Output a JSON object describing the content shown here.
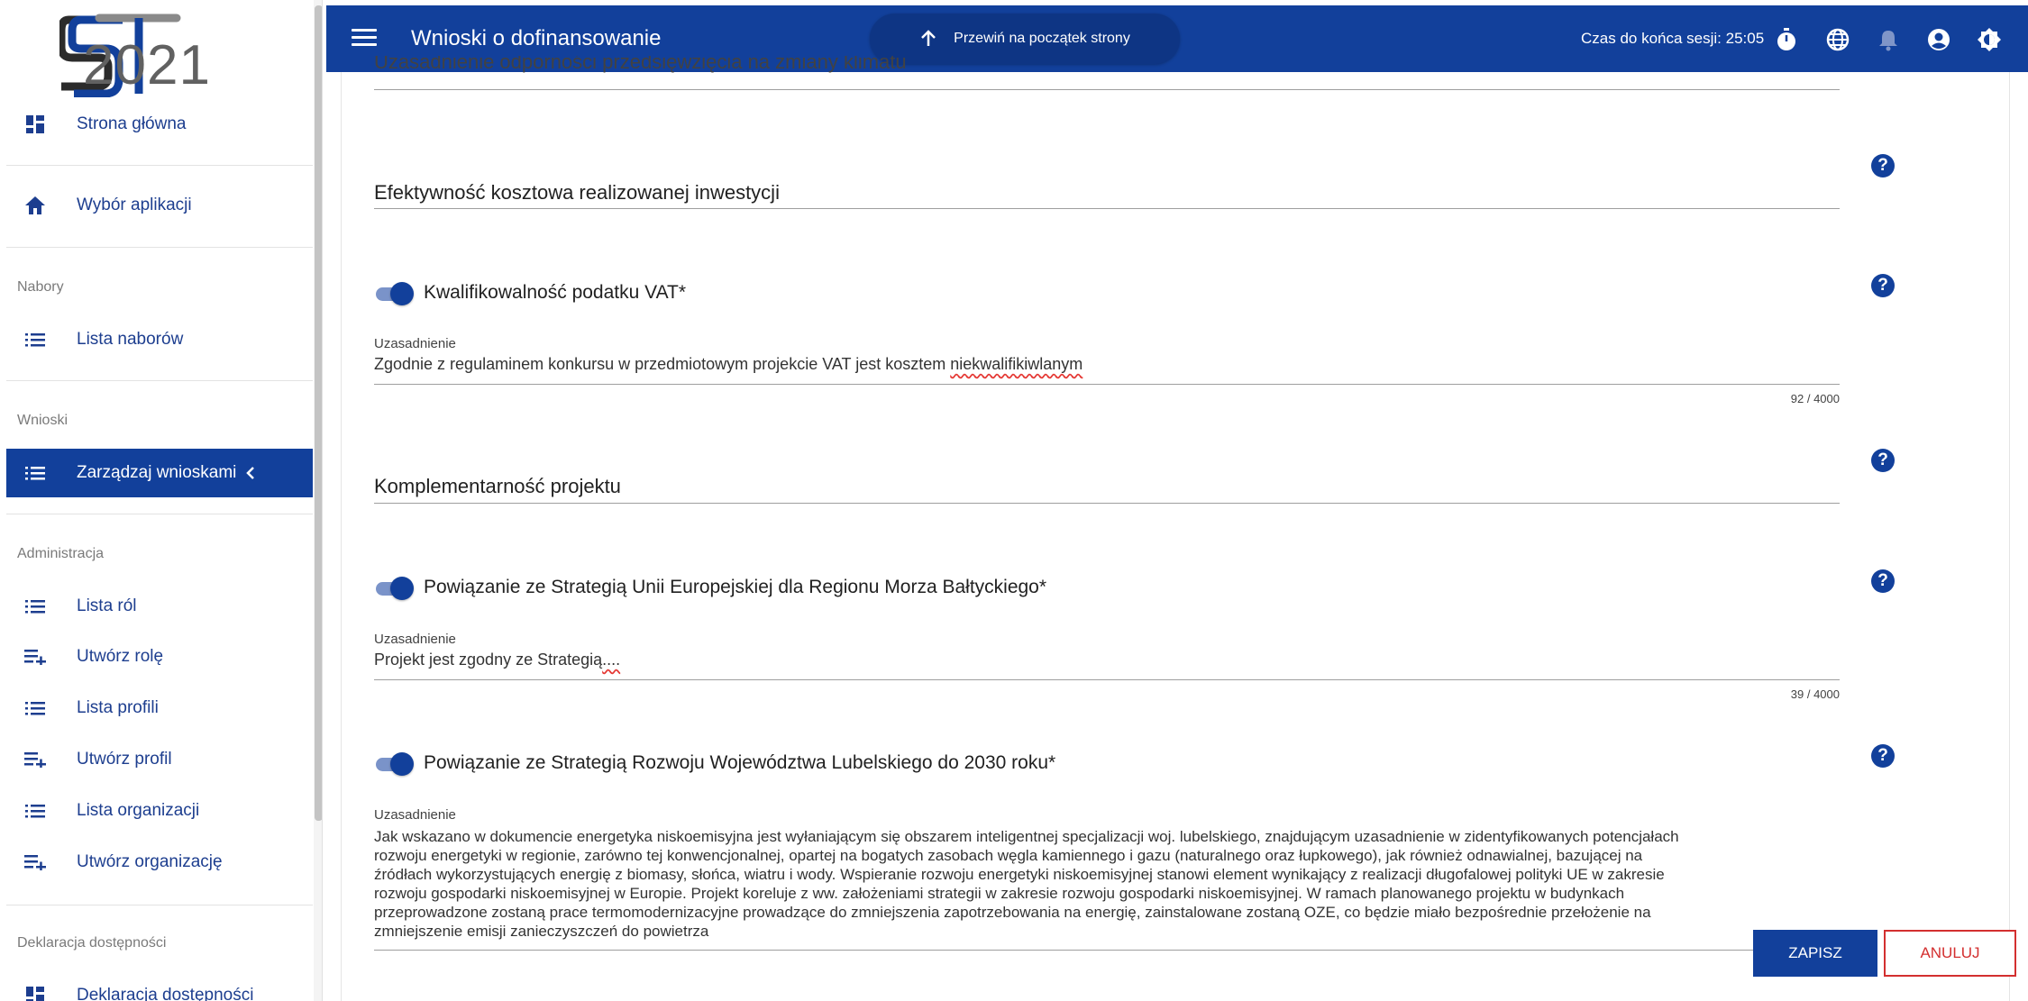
{
  "logo": {
    "year": "2021",
    "icon": "cst-logo-icon"
  },
  "colors": {
    "primary": "#12409b",
    "link": "#1d3e8f",
    "danger": "#d32f2f",
    "toggle_track": "#7a93c9"
  },
  "sidebar": {
    "items": [
      {
        "label": "Strona główna",
        "icon": "dashboard-icon"
      },
      {
        "label": "Wybór aplikacji",
        "icon": "home-icon"
      },
      {
        "label": "Lista naborów",
        "icon": "list-icon"
      },
      {
        "label": "Zarządzaj wnioskami",
        "icon": "list-icon",
        "active": true
      },
      {
        "label": "Lista ról",
        "icon": "list-icon"
      },
      {
        "label": "Utwórz rolę",
        "icon": "playlist-add-icon"
      },
      {
        "label": "Lista profili",
        "icon": "list-icon"
      },
      {
        "label": "Utwórz profil",
        "icon": "playlist-add-icon"
      },
      {
        "label": "Lista organizacji",
        "icon": "list-icon"
      },
      {
        "label": "Utwórz organizację",
        "icon": "playlist-add-icon"
      },
      {
        "label": "Deklaracja dostępności",
        "icon": "dashboard-icon"
      }
    ],
    "sections": [
      "Nabory",
      "Wnioski",
      "Administracja",
      "Deklaracja dostępności"
    ]
  },
  "topbar": {
    "title": "Wnioski o dofinansowanie",
    "scroll_top_label": "Przewiń na początek strony",
    "session_text": "Czas do końca sesji: 25:05",
    "icons": [
      "timer-icon",
      "globe-icon",
      "bell-icon",
      "account-icon",
      "contrast-icon"
    ]
  },
  "form": {
    "cut_title": "Uzasadnienie odporności przedsięwzięcia na zmiany klimatu",
    "cost_efficiency_title": "Efektywność kosztowa realizowanej inwestycji",
    "vat": {
      "label": "Kwalifikowalność podatku VAT*",
      "sublabel": "Uzasadnienie",
      "value_prefix": "Zgodnie z regulaminem konkursu w przedmiotowym projekcie VAT jest kosztem ",
      "value_misspelled": "niekwalifikiwlanym",
      "counter": "92 / 4000"
    },
    "complementarity_title": "Komplementarność projektu",
    "baltic": {
      "label": "Powiązanie ze Strategią Unii Europejskiej dla Regionu Morza Bałtyckiego*",
      "sublabel": "Uzasadnienie",
      "value_prefix": "Projekt jest zgodny ze Strategią",
      "value_misspelled": "....",
      "counter": "39 / 4000"
    },
    "lublin": {
      "label": "Powiązanie ze Strategią Rozwoju Województwa Lubelskiego do 2030 roku*",
      "sublabel": "Uzasadnienie",
      "lines": [
        "Jak wskazano w dokumencie energetyka niskoemisyjna jest wyłaniającym się obszarem inteligentnej specjalizacji woj. lubelskiego, znajdującym uzasadnienie w zidentyfikowanych potencjałach",
        "rozwoju energetyki w regionie, zarówno tej konwencjonalnej, opartej na bogatych zasobach węgla kamiennego i gazu (naturalnego oraz łupkowego), jak również odnawialnej, bazującej na",
        "źródłach wykorzystujących energię z biomasy, słońca, wiatru i wody. Wspieranie rozwoju energetyki niskoemisyjnej stanowi element wynikający z realizacji długofalowej polityki UE w zakresie",
        "rozwoju gospodarki niskoemisyjnej w Europie. Projekt koreluje z ww. założeniami strategii w zakresie rozwoju gospodarki niskoemisyjnej. W ramach planowanego projektu w budynkach",
        "przeprowadzone zostaną  prace termomodernizacyjne prowadzące do zmniejszenia zapotrzebowania na energię, zainstalowane zostaną OZE, co będzie miało bezpośrednie przełożenie na",
        "zmniejszenie emisji zanieczyszczeń do powietrza"
      ]
    },
    "help_symbol": "?"
  },
  "buttons": {
    "save": "ZAPISZ",
    "cancel": "ANULUJ"
  }
}
